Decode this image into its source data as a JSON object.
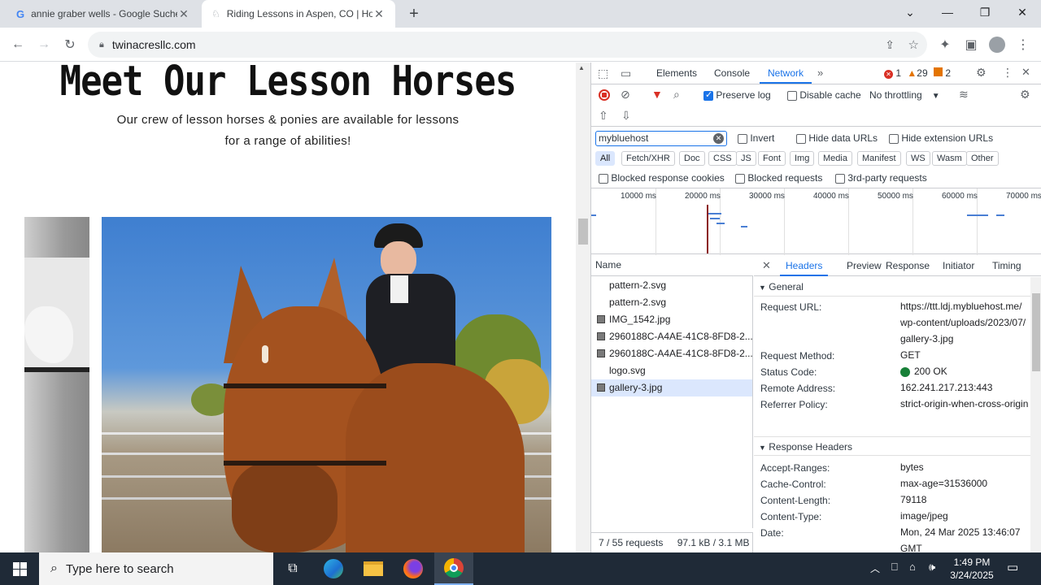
{
  "browser": {
    "tabs": [
      {
        "title": "annie graber wells - Google Suche",
        "favicon": "google-icon",
        "active": false
      },
      {
        "title": "Riding Lessons in Aspen, CO | Horseback Riding",
        "favicon": "horse-icon",
        "active": true
      }
    ],
    "url": "twinacresllc.com"
  },
  "page": {
    "heading": "Meet Our Lesson Horses",
    "subtitle_line1": "Our crew of lesson horses & ponies are available for lessons",
    "subtitle_line2": "for a range of abilities!"
  },
  "devtools": {
    "tabs": [
      "Elements",
      "Console",
      "Network"
    ],
    "active_tab": "Network",
    "issues": {
      "errors": "1",
      "warnings": "29",
      "info": "2"
    },
    "toolbar": {
      "preserve_log": "Preserve log",
      "disable_cache": "Disable cache",
      "throttling": "No throttling"
    },
    "filter": {
      "value": "mybluehost",
      "invert": "Invert",
      "hide_data_urls": "Hide data URLs",
      "hide_extension_urls": "Hide extension URLs",
      "types": [
        "All",
        "Fetch/XHR",
        "Doc",
        "CSS",
        "JS",
        "Font",
        "Img",
        "Media",
        "Manifest",
        "WS",
        "Wasm",
        "Other"
      ],
      "blocked_response_cookies": "Blocked response cookies",
      "blocked_requests": "Blocked requests",
      "third_party": "3rd-party requests"
    },
    "timeline_ticks": [
      "10000 ms",
      "20000 ms",
      "30000 ms",
      "40000 ms",
      "50000 ms",
      "60000 ms",
      "70000 ms"
    ],
    "requests_header": "Name",
    "requests": [
      "pattern-2.svg",
      "pattern-2.svg",
      "IMG_1542.jpg",
      "2960188C-A4AE-41C8-8FD8-2...",
      "2960188C-A4AE-41C8-8FD8-2...",
      "logo.svg",
      "gallery-3.jpg"
    ],
    "status_bar": {
      "requests": "7 / 55 requests",
      "transferred": "97.1 kB / 3.1 MB"
    },
    "detail_tabs": [
      "Headers",
      "Preview",
      "Response",
      "Initiator",
      "Timing"
    ],
    "general_title": "General",
    "general": [
      {
        "key": "Request URL:",
        "value": "https://ttt.ldj.mybluehost.me/wp-content/uploads/2023/07/gallery-3.jpg"
      },
      {
        "key": "Request Method:",
        "value": "GET"
      },
      {
        "key": "Status Code:",
        "value": "200 OK"
      },
      {
        "key": "Remote Address:",
        "value": "162.241.217.213:443"
      },
      {
        "key": "Referrer Policy:",
        "value": "strict-origin-when-cross-origin"
      }
    ],
    "response_headers_title": "Response Headers",
    "response_headers": [
      {
        "key": "Accept-Ranges:",
        "value": "bytes"
      },
      {
        "key": "Cache-Control:",
        "value": "max-age=31536000"
      },
      {
        "key": "Content-Length:",
        "value": "79118"
      },
      {
        "key": "Content-Type:",
        "value": "image/jpeg"
      },
      {
        "key": "Date:",
        "value": "Mon, 24 Mar 2025 13:46:07 GMT"
      }
    ]
  },
  "taskbar": {
    "search_placeholder": "Type here to search",
    "time": "1:49 PM",
    "date": "3/24/2025"
  },
  "colors": {
    "accent": "#1a73e8",
    "taskbar": "#1f2a37",
    "error": "#d93025",
    "warning": "#e37400",
    "status_ok": "#188038"
  }
}
